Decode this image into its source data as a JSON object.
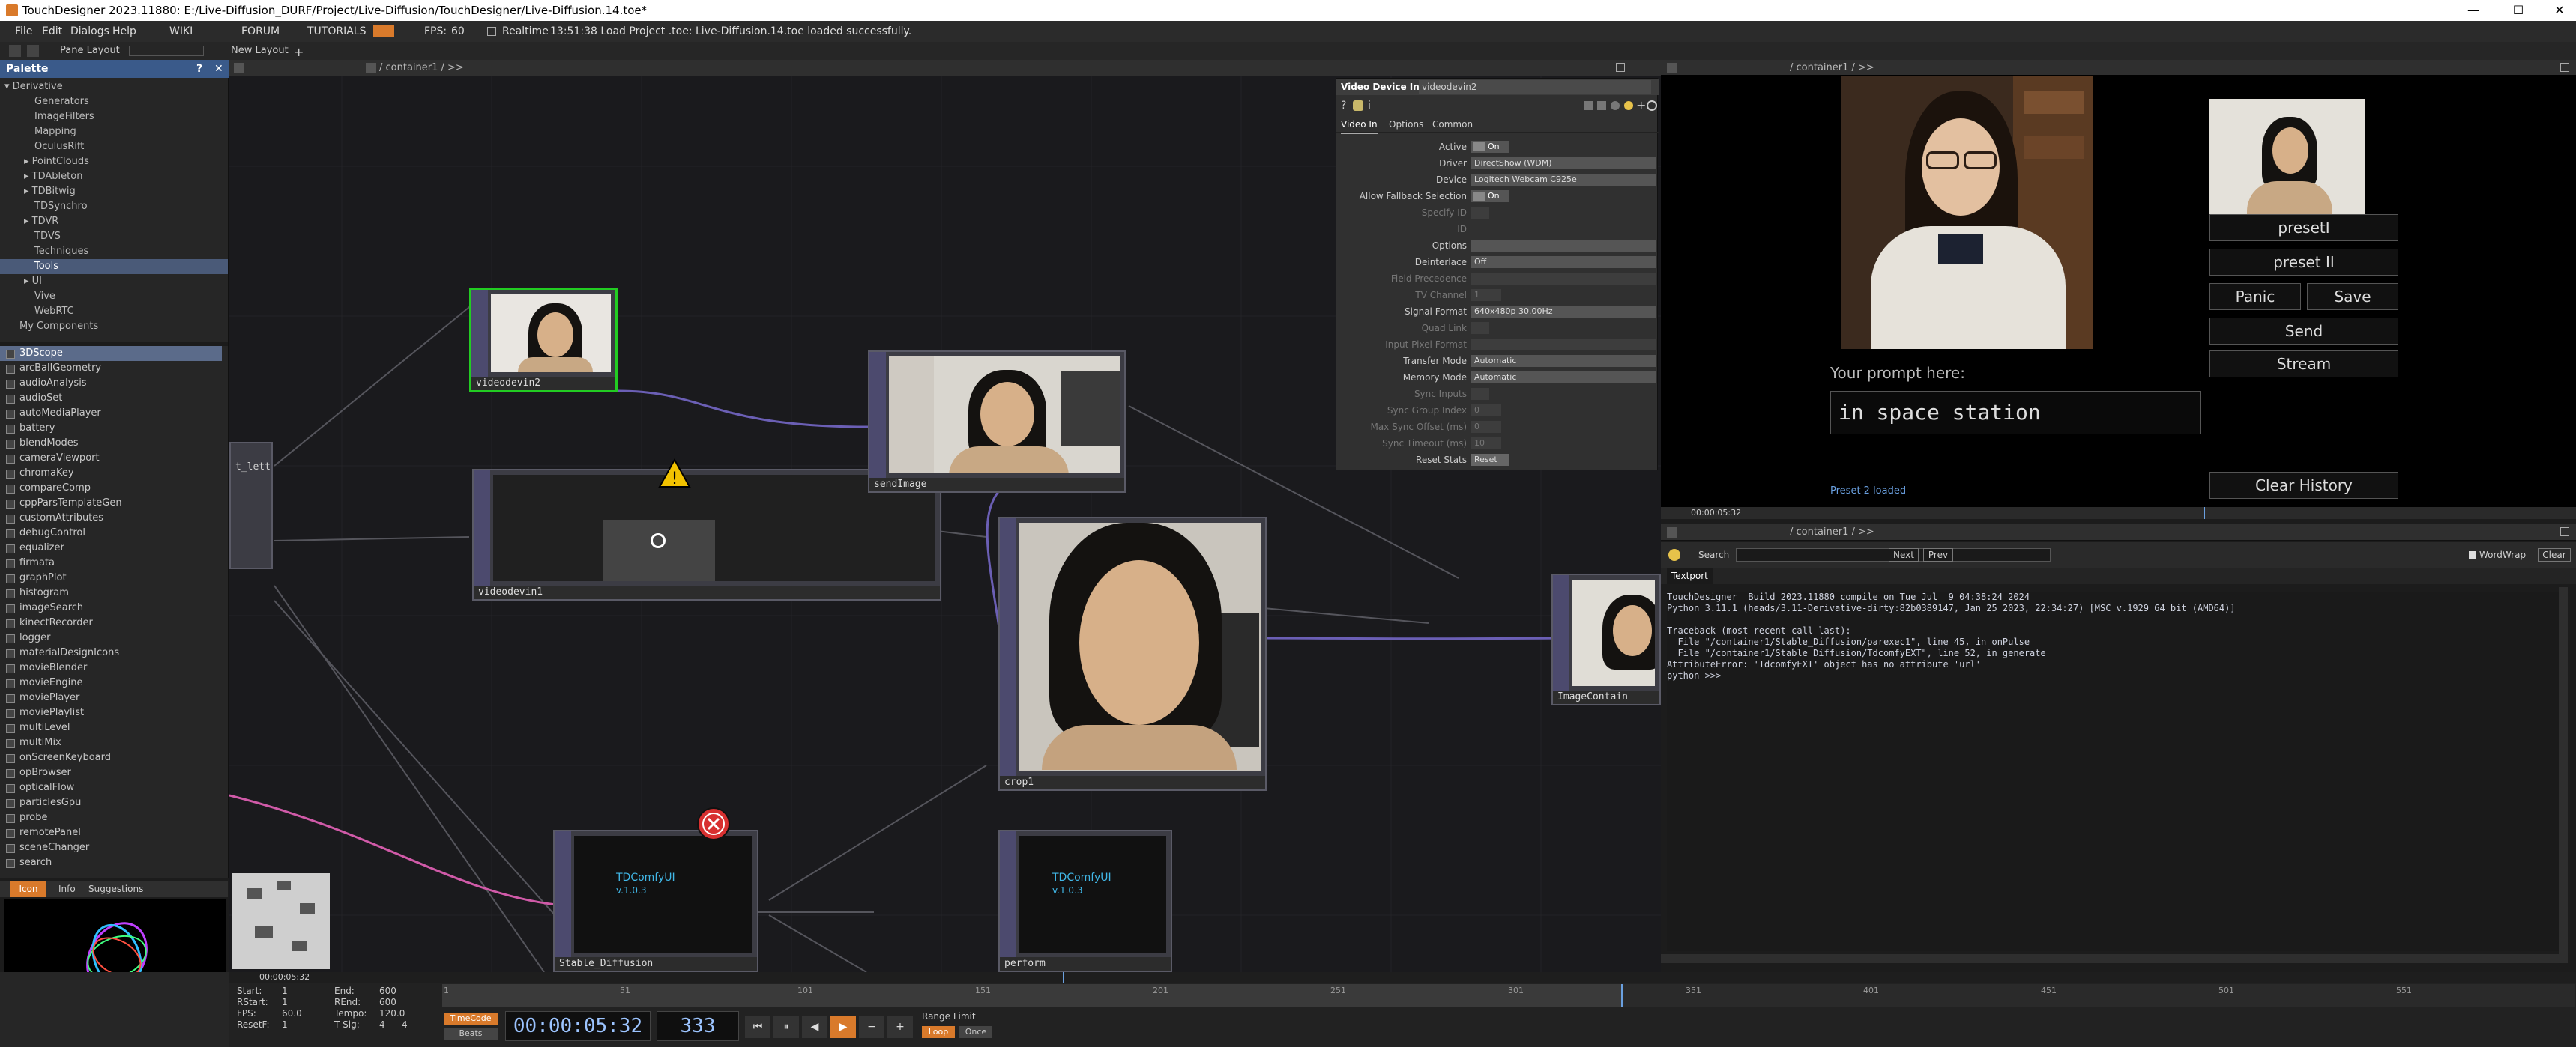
{
  "titlebar": {
    "title": "TouchDesigner 2023.11880: E:/Live-Diffusion_DURF/Project/Live-Diffusion/TouchDesigner/Live-Diffusion.14.toe*",
    "min": "—",
    "max": "☐",
    "close": "✕"
  },
  "menubar": {
    "file": "File",
    "edit": "Edit",
    "dialogs": "Dialogs",
    "help": "Help",
    "wiki": "WIKI",
    "forum": "FORUM",
    "tutorials": "TUTORIALS",
    "fps_label": "FPS:",
    "fps": "60",
    "realtime": "Realtime",
    "status": "13:51:38 Load Project .toe: Live-Diffusion.14.toe loaded successfully."
  },
  "toolbar": {
    "pane_layout": "Pane Layout",
    "new_layout": "New Layout"
  },
  "palette": {
    "title": "Palette",
    "tree": [
      "Derivative",
      "Generators",
      "ImageFilters",
      "Mapping",
      "OculusRift",
      "PointClouds",
      "TDAbleton",
      "TDBitwig",
      "TDSynchro",
      "TDVR",
      "TDVS",
      "Techniques",
      "Tools",
      "UI",
      "Vive",
      "WebRTC",
      "My Components"
    ],
    "selected_tree": "Tools",
    "items": [
      "3DScope",
      "arcBallGeometry",
      "audioAnalysis",
      "audioSet",
      "autoMediaPlayer",
      "battery",
      "blendModes",
      "cameraViewport",
      "chromaKey",
      "compareComp",
      "cppParsTemplateGen",
      "customAttributes",
      "debugControl",
      "equalizer",
      "firmata",
      "graphPlot",
      "histogram",
      "imageSearch",
      "kinectRecorder",
      "logger",
      "materialDesignIcons",
      "movieBlender",
      "movieEngine",
      "moviePlayer",
      "moviePlaylist",
      "multiLevel",
      "multiMix",
      "onScreenKeyboard",
      "opBrowser",
      "opticalFlow",
      "particlesGpu",
      "probe",
      "remotePanel",
      "sceneChanger",
      "search"
    ],
    "selected_item": "3DScope",
    "tabs": [
      "Icon",
      "Info",
      "Suggestions"
    ]
  },
  "network": {
    "path": "/ container1 / >>",
    "nodes": {
      "videodevin2": "videodevin2",
      "videodevin1": "videodevin1",
      "sendImage": "sendImage",
      "crop1": "crop1",
      "stable_diffusion": "Stable_Diffusion",
      "perform": "perform",
      "imagecontain": "ImageContain",
      "partial": "t_lett",
      "tdcomfy_title": "TDComfyUI",
      "tdcomfy_version": "v.1.0.3"
    }
  },
  "param_panel": {
    "op_type": "Video Device In",
    "op_name": "videodevin2",
    "tabs": [
      "Video In",
      "Options",
      "Common"
    ],
    "params": [
      {
        "label": "Active",
        "value": "On",
        "kind": "toggle"
      },
      {
        "label": "Driver",
        "value": "DirectShow (WDM)",
        "kind": "menu"
      },
      {
        "label": "Device",
        "value": "Logitech Webcam C925e",
        "kind": "menu"
      },
      {
        "label": "Allow Fallback Selection",
        "value": "On",
        "kind": "toggle"
      },
      {
        "label": "Specify ID",
        "value": "",
        "kind": "dim"
      },
      {
        "label": "ID",
        "value": "",
        "kind": "dim"
      },
      {
        "label": "Options",
        "value": "",
        "kind": "menu"
      },
      {
        "label": "Deinterlace",
        "value": "Off",
        "kind": "menu"
      },
      {
        "label": "Field Precedence",
        "value": "",
        "kind": "dim"
      },
      {
        "label": "TV Channel",
        "value": "1",
        "kind": "dim"
      },
      {
        "label": "Signal Format",
        "value": "640x480p 30.00Hz",
        "kind": "menu"
      },
      {
        "label": "Quad Link",
        "value": "",
        "kind": "dim"
      },
      {
        "label": "Input Pixel Format",
        "value": "",
        "kind": "dim"
      },
      {
        "label": "Transfer Mode",
        "value": "Automatic",
        "kind": "menu"
      },
      {
        "label": "Memory Mode",
        "value": "Automatic",
        "kind": "menu"
      },
      {
        "label": "Sync Inputs",
        "value": "",
        "kind": "dim"
      },
      {
        "label": "Sync Group Index",
        "value": "0",
        "kind": "dim"
      },
      {
        "label": "Max Sync Offset (ms)",
        "value": "0",
        "kind": "dim"
      },
      {
        "label": "Sync Timeout (ms)",
        "value": "10",
        "kind": "dim"
      },
      {
        "label": "Reset Stats",
        "value": "Reset",
        "kind": "button"
      }
    ]
  },
  "viewer": {
    "path": "/ container1 / >>",
    "prompt_label": "Your prompt here:",
    "prompt_value": "in space station",
    "buttons": {
      "preset1": "presetI",
      "preset2": "preset II",
      "panic": "Panic",
      "save": "Save",
      "send": "Send",
      "stream": "Stream",
      "clear_history": "Clear History"
    },
    "status": "Preset 2 loaded",
    "timecode": "00:00:05:32"
  },
  "textport": {
    "path": "/ container1 / >>",
    "search_label": "Search",
    "next": "Next",
    "prev": "Prev",
    "wordwrap": "WordWrap",
    "clear": "Clear",
    "tab": "Textport",
    "lines": [
      "TouchDesigner  Build 2023.11880 compile on Tue Jul  9 04:38:24 2024",
      "Python 3.11.1 (heads/3.11-Derivative-dirty:82b0389147, Jan 25 2023, 22:34:27) [MSC v.1929 64 bit (AMD64)]",
      "",
      "Traceback (most recent call last):",
      "  File \"/container1/Stable_Diffusion/parexec1\", line 45, in onPulse",
      "  File \"/container1/Stable_Diffusion/TdcomfyEXT\", line 52, in generate",
      "AttributeError: 'TdcomfyEXT' object has no attribute 'url'",
      "python >>>"
    ]
  },
  "timeline": {
    "start_label": "Start:",
    "start": "1",
    "end_label": "End:",
    "end": "600",
    "rstart_label": "RStart:",
    "rstart": "1",
    "rend_label": "REnd:",
    "rend": "600",
    "fps_label": "FPS:",
    "fps": "60.0",
    "tempo_label": "Tempo:",
    "tempo": "120.0",
    "resetf_label": "ResetF:",
    "resetf": "1",
    "tsig_label": "T Sig:",
    "tsig_a": "4",
    "tsig_b": "4",
    "timecode_btn": "TimeCode",
    "beats_btn": "Beats",
    "timecode": "00:00:05:32",
    "frame": "333",
    "range_limit": "Range Limit",
    "loop": "Loop",
    "once": "Once",
    "ruler": [
      "1",
      "51",
      "101",
      "151",
      "201",
      "251",
      "301",
      "351",
      "401",
      "451",
      "501",
      "551"
    ],
    "mini_timecode": "00:00:05:32",
    "play_fraction": 0.553
  },
  "colors": {
    "accent": "#e08a2c",
    "palette_header": "#3a5a8a",
    "node_selected": "#22cc22",
    "wire": "#6b5fb5",
    "wire_pink": "#d05aa8",
    "error": "#d83030",
    "warning": "#f2c200"
  }
}
